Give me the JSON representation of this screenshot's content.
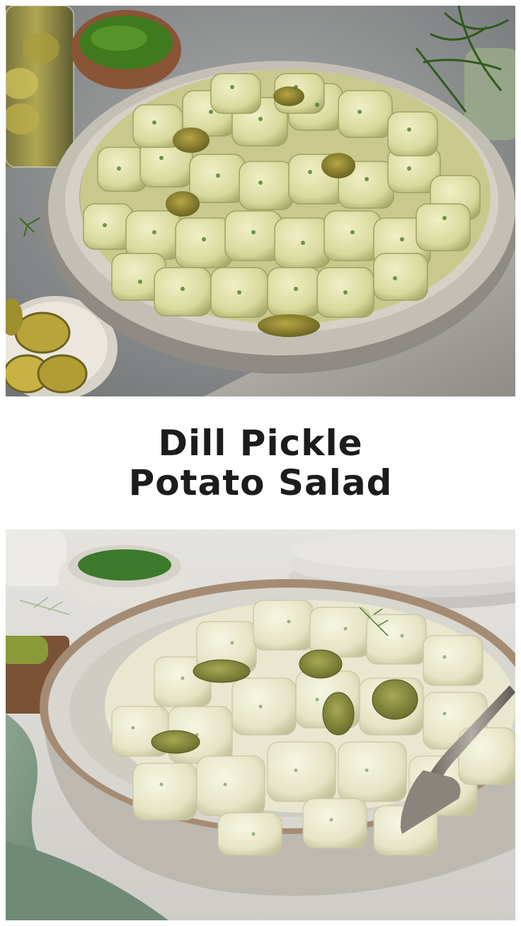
{
  "title": {
    "line1": "Dill Pickle",
    "line2": "Potato Salad"
  },
  "colors": {
    "background": "#ffffff",
    "title_text": "#1c1c1c",
    "dill_green": "#3f7a1e",
    "pickle_green": "#7a8a2a",
    "potato_cream": "#e8e6b8",
    "bowl_gray": "#bdb7ad",
    "table_gray": "#8f9293",
    "napkin_sage": "#7f9a86"
  }
}
